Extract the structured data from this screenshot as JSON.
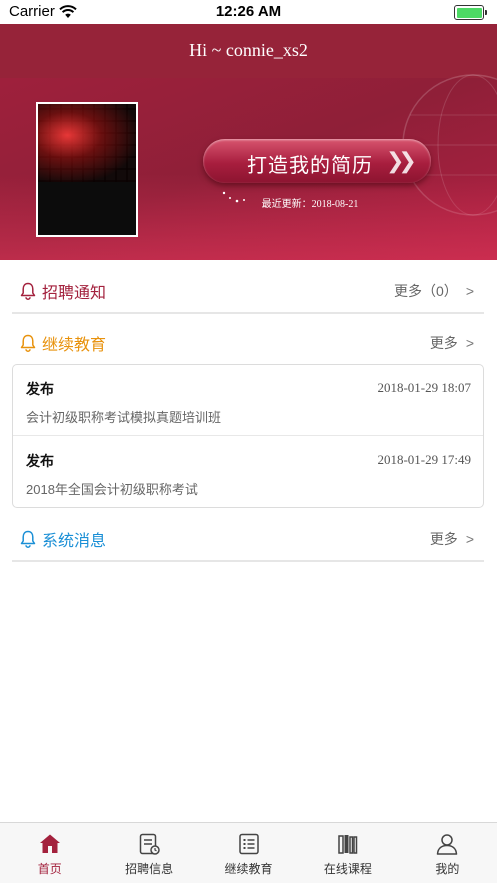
{
  "status_bar": {
    "carrier": "Carrier",
    "time": "12:26 AM",
    "battery_level": 1.0
  },
  "header": {
    "greeting": "Hi ~ connie_xs2",
    "resume_button": "打造我的简历",
    "last_updated": "最近更新：2018-08-21",
    "icons": [
      "wifi-icon",
      "battery-icon",
      "chevrons-right-icon"
    ]
  },
  "sections": {
    "recruitment": {
      "title": "招聘通知",
      "more": "更多（0）",
      "color": "#a3213d"
    },
    "education": {
      "title": "继续教育",
      "more": "更多",
      "color": "#e8920d",
      "items": [
        {
          "type": "发布",
          "date": "2018-01-29 18:07",
          "title": "会计初级职称考试模拟真题培训班"
        },
        {
          "type": "发布",
          "date": "2018-01-29 17:49",
          "title": "2018年全国会计初级职称考试"
        }
      ]
    },
    "system": {
      "title": "系统消息",
      "more": "更多",
      "color": "#1a8fd6"
    }
  },
  "tab_bar": {
    "active_index": 0,
    "active_color": "#a3213d",
    "tabs": [
      {
        "label": "首页",
        "icon": "home-icon"
      },
      {
        "label": "招聘信息",
        "icon": "document-clock-icon"
      },
      {
        "label": "继续教育",
        "icon": "list-icon"
      },
      {
        "label": "在线课程",
        "icon": "books-icon"
      },
      {
        "label": "我的",
        "icon": "user-icon"
      }
    ]
  }
}
